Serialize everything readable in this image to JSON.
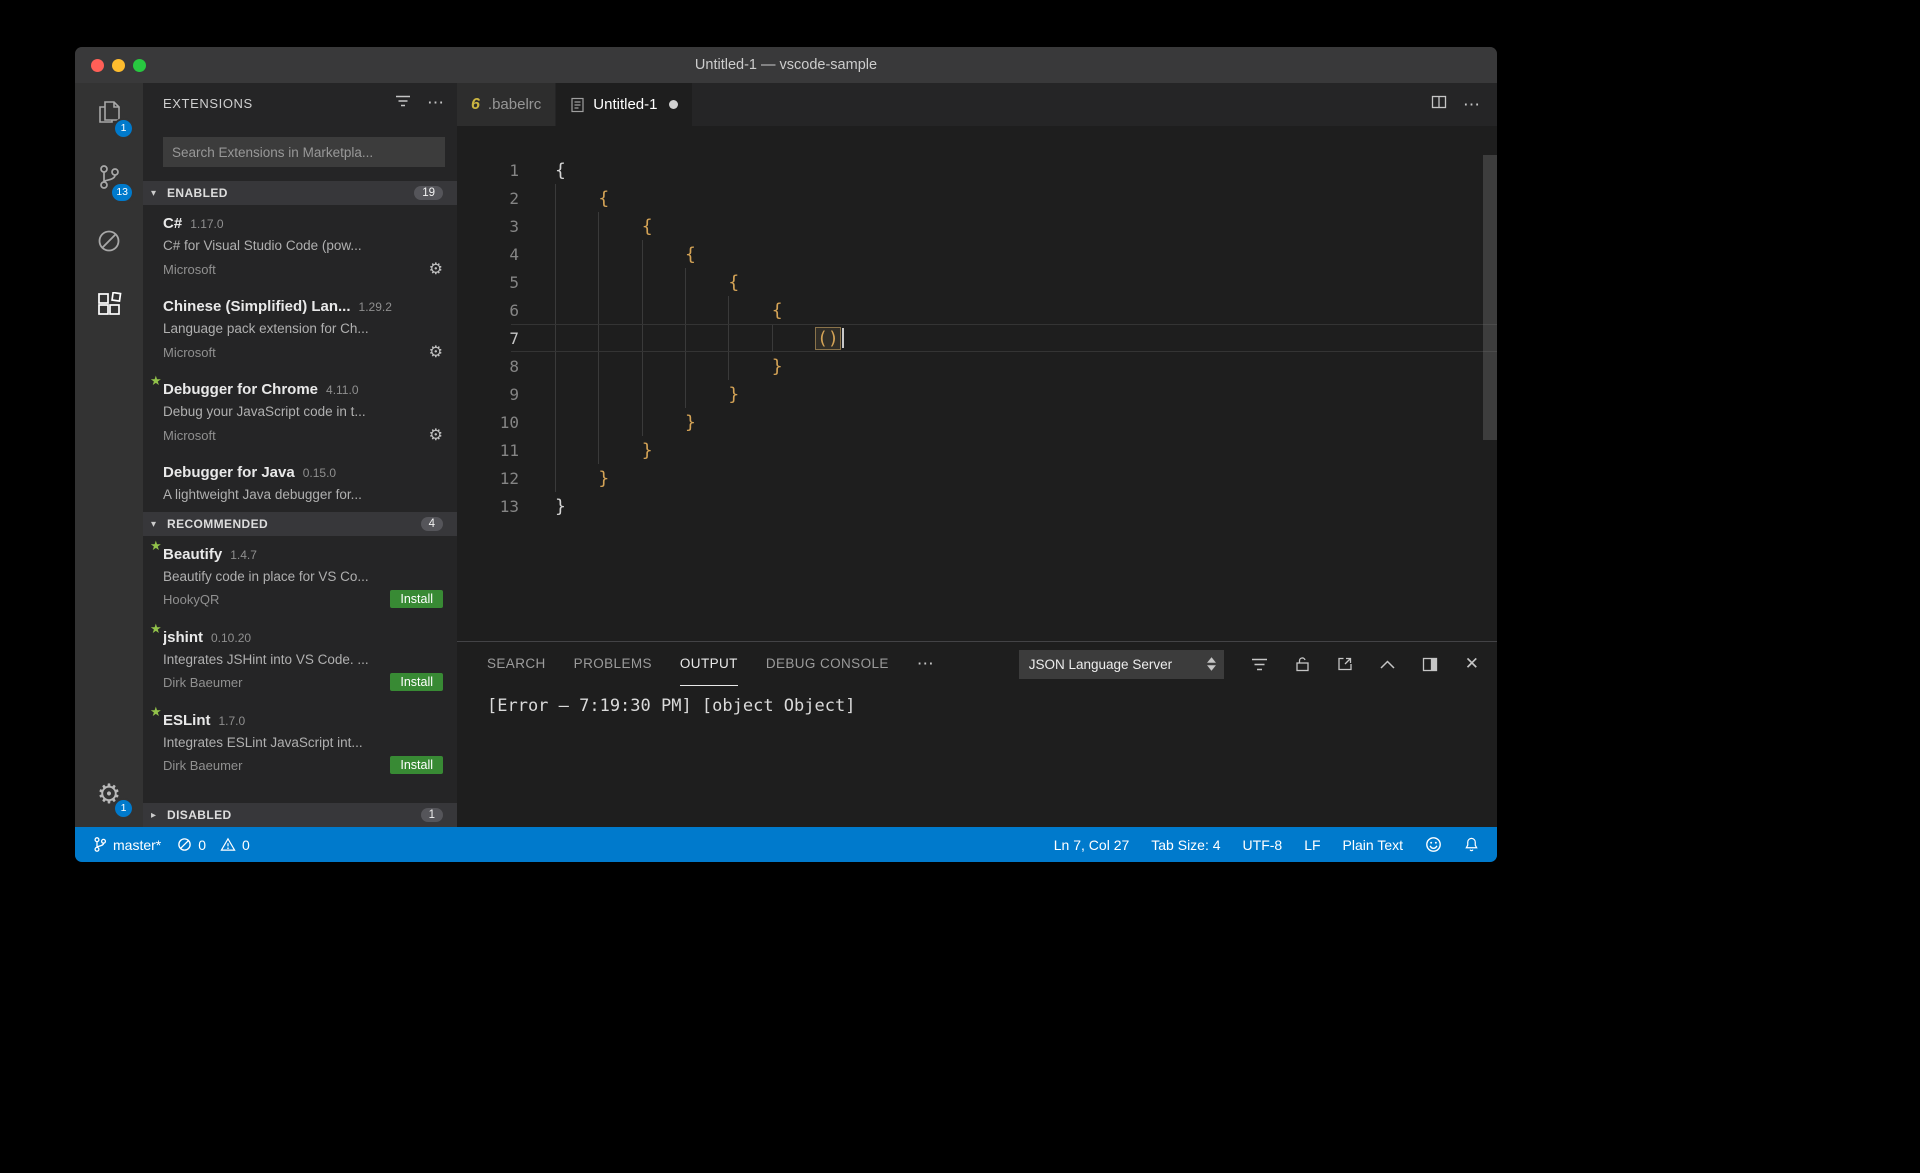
{
  "window": {
    "title": "Untitled-1 — vscode-sample"
  },
  "colors": {
    "accent_blue": "#007acc",
    "install_green": "#388a34",
    "brace_gold": "#d4a356",
    "babel_yellow": "#cbb541",
    "star_green": "#92c24a"
  },
  "activity_bar": {
    "items": [
      {
        "icon": "files-icon",
        "badge": "1",
        "active": false
      },
      {
        "icon": "source-control-icon",
        "badge": "13",
        "active": false
      },
      {
        "icon": "debug-icon",
        "badge": "",
        "active": false
      },
      {
        "icon": "extensions-icon",
        "badge": "",
        "active": true
      }
    ],
    "settings": {
      "icon": "gear-icon",
      "badge": "1"
    }
  },
  "sidebar": {
    "title": "EXTENSIONS",
    "search": {
      "placeholder": "Search Extensions in Marketpla..."
    },
    "install_label": "Install",
    "sections": [
      {
        "label": "ENABLED",
        "count": "19",
        "collapsed": false,
        "items": [
          {
            "name": "C#",
            "version": "1.17.0",
            "description": "C# for Visual Studio Code (pow...",
            "author": "Microsoft",
            "action": "gear",
            "starred": false
          },
          {
            "name": "Chinese (Simplified) Lan...",
            "version": "1.29.2",
            "description": "Language pack extension for Ch...",
            "author": "Microsoft",
            "action": "gear",
            "starred": false
          },
          {
            "name": "Debugger for Chrome",
            "version": "4.11.0",
            "description": "Debug your JavaScript code in t...",
            "author": "Microsoft",
            "action": "gear",
            "starred": true
          },
          {
            "name": "Debugger for Java",
            "version": "0.15.0",
            "description": "A lightweight Java debugger for...",
            "author": "",
            "action": "none",
            "starred": false
          }
        ]
      },
      {
        "label": "RECOMMENDED",
        "count": "4",
        "collapsed": false,
        "items": [
          {
            "name": "Beautify",
            "version": "1.4.7",
            "description": "Beautify code in place for VS Co...",
            "author": "HookyQR",
            "action": "install",
            "starred": true
          },
          {
            "name": "jshint",
            "version": "0.10.20",
            "description": "Integrates JSHint into VS Code. ...",
            "author": "Dirk Baeumer",
            "action": "install",
            "starred": true
          },
          {
            "name": "ESLint",
            "version": "1.7.0",
            "description": "Integrates ESLint JavaScript int...",
            "author": "Dirk Baeumer",
            "action": "install",
            "starred": true
          }
        ]
      },
      {
        "label": "DISABLED",
        "count": "1",
        "collapsed": true,
        "items": []
      }
    ]
  },
  "editor": {
    "tabs": [
      {
        "label": ".babelrc",
        "icon": "babel-icon",
        "active": false,
        "dirty": false
      },
      {
        "label": "Untitled-1",
        "icon": "file-icon",
        "active": true,
        "dirty": true
      }
    ],
    "code_lines": [
      {
        "num": "1",
        "indent": 0,
        "text": "{",
        "kind": "outer",
        "current": false
      },
      {
        "num": "2",
        "indent": 1,
        "text": "{",
        "kind": "inner",
        "current": false
      },
      {
        "num": "3",
        "indent": 2,
        "text": "{",
        "kind": "inner",
        "current": false
      },
      {
        "num": "4",
        "indent": 3,
        "text": "{",
        "kind": "inner",
        "current": false
      },
      {
        "num": "5",
        "indent": 4,
        "text": "{",
        "kind": "inner",
        "current": false
      },
      {
        "num": "6",
        "indent": 5,
        "text": "{",
        "kind": "inner",
        "current": false
      },
      {
        "num": "7",
        "indent": 6,
        "text": "()",
        "kind": "cursor",
        "current": true
      },
      {
        "num": "8",
        "indent": 5,
        "text": "}",
        "kind": "inner",
        "current": false
      },
      {
        "num": "9",
        "indent": 4,
        "text": "}",
        "kind": "inner",
        "current": false
      },
      {
        "num": "10",
        "indent": 3,
        "text": "}",
        "kind": "inner",
        "current": false
      },
      {
        "num": "11",
        "indent": 2,
        "text": "}",
        "kind": "inner",
        "current": false
      },
      {
        "num": "12",
        "indent": 1,
        "text": "}",
        "kind": "inner",
        "current": false
      },
      {
        "num": "13",
        "indent": 0,
        "text": "}",
        "kind": "outer",
        "current": false
      }
    ]
  },
  "panel": {
    "tabs": [
      {
        "label": "SEARCH",
        "active": false
      },
      {
        "label": "PROBLEMS",
        "active": false
      },
      {
        "label": "OUTPUT",
        "active": true
      },
      {
        "label": "DEBUG CONSOLE",
        "active": false
      }
    ],
    "channel_select": "JSON Language Server",
    "output_text": "[Error — 7:19:30 PM] [object Object]"
  },
  "status_bar": {
    "branch": "master*",
    "errors": "0",
    "warnings": "0",
    "right_items": [
      "Ln 7, Col 27",
      "Tab Size: 4",
      "UTF-8",
      "LF",
      "Plain Text"
    ]
  }
}
